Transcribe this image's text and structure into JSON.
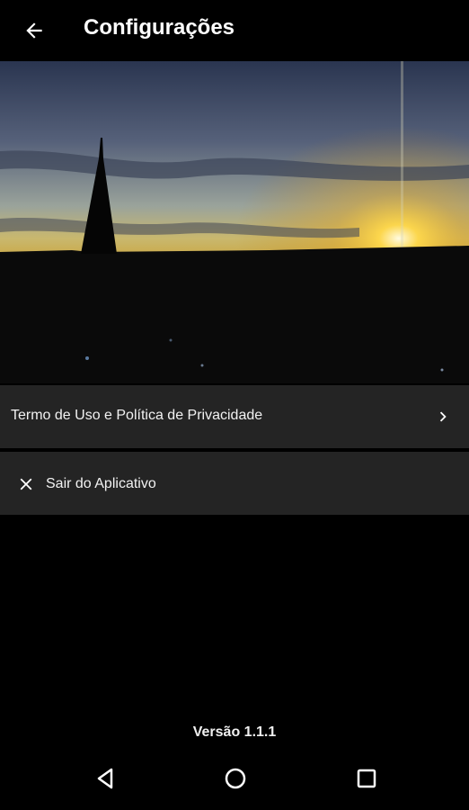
{
  "app_bar": {
    "title": "Configurações",
    "back_icon": "arrow-left-icon"
  },
  "hero": {
    "image": "sunset-skyline-with-church-spire"
  },
  "menu": {
    "items": [
      {
        "label": "Termo de Uso e Política de Privacidade",
        "icon": "chevron-right-icon"
      },
      {
        "label": "Sair do Aplicativo",
        "icon": "close-icon"
      }
    ]
  },
  "footer": {
    "version": "Versão 1.1.1"
  },
  "system_nav": {
    "buttons": [
      "nav-back-icon",
      "nav-home-icon",
      "nav-recents-icon"
    ]
  },
  "colors": {
    "background": "#000000",
    "row_background": "#242424",
    "text": "#ffffff"
  }
}
